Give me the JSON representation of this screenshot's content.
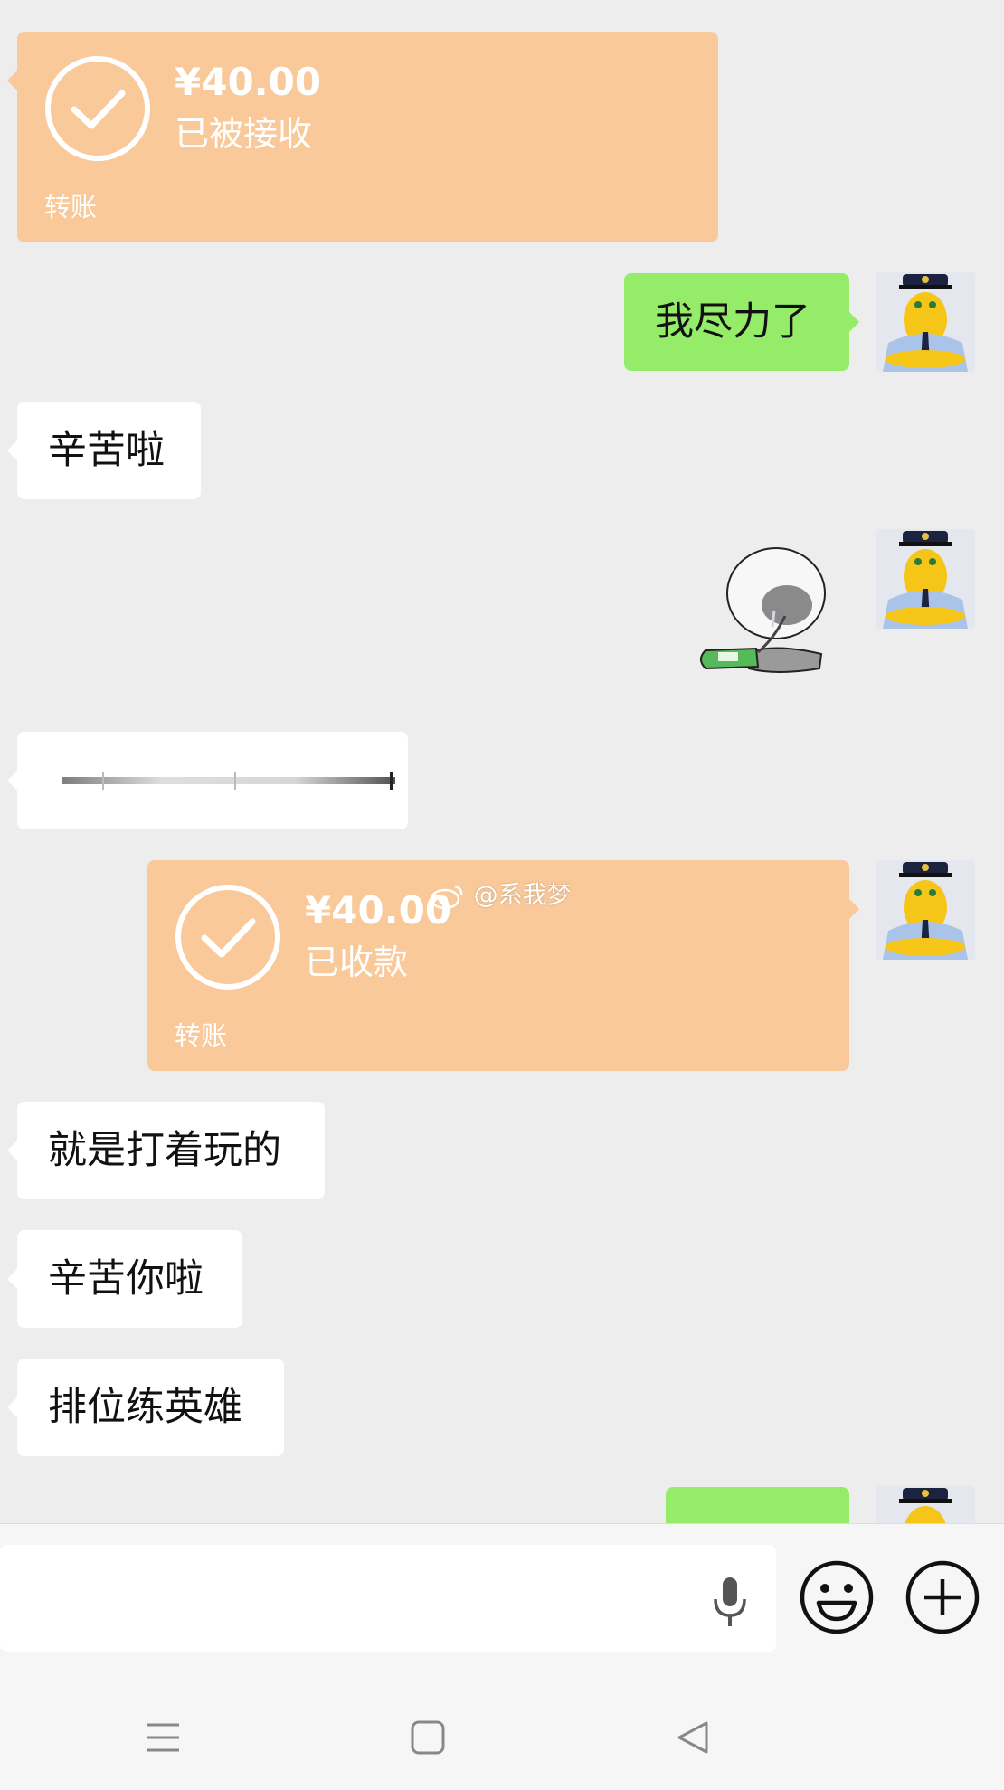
{
  "messages": {
    "transfer_received": {
      "amount": "¥40.00",
      "status": "已被接收",
      "label": "转账"
    },
    "sent_1": "我尽力了",
    "recv_1": "辛苦啦",
    "transfer_collected": {
      "amount": "¥40.00",
      "status": "已收款",
      "label": "转账"
    },
    "recv_2": "就是打着玩的",
    "recv_3": "辛苦你啦",
    "recv_4": "排位练英雄"
  },
  "watermark": {
    "text": "@系我梦",
    "icon": "weibo-icon"
  },
  "colors": {
    "background": "#ededed",
    "sent_bubble": "#95ec69",
    "received_bubble": "#ffffff",
    "transfer_card": "#f9c99a",
    "bottom_bar": "#f6f6f6"
  },
  "input_bar": {
    "icons": [
      "microphone-icon",
      "emoji-icon",
      "plus-icon"
    ]
  },
  "navbar": {
    "icons": [
      "menu-icon",
      "home-square-icon",
      "back-triangle-icon"
    ]
  }
}
